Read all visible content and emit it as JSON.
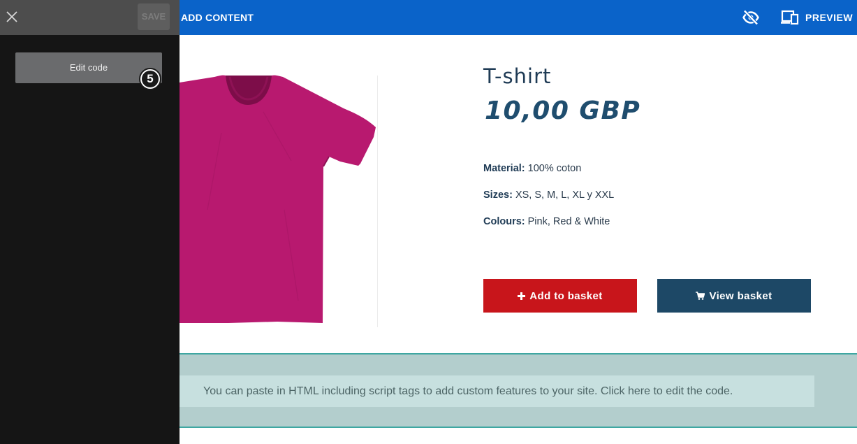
{
  "topbar": {
    "add_content_label": "ADD CONTENT",
    "preview_label": "PREVIEW",
    "background_color": "#0a63c9",
    "icons": [
      "visibility-off-icon",
      "devices-icon"
    ]
  },
  "side_panel": {
    "save_label": "SAVE",
    "edit_code_label": "Edit code",
    "step_badge": "5",
    "icons": [
      "close-icon"
    ]
  },
  "product": {
    "title": "T-shirt",
    "price": "10,00 GBP",
    "material_label": "Material:",
    "material_value": "100% coton",
    "sizes_label": "Sizes:",
    "sizes_value": "XS, S, M, L, XL y XXL",
    "colours_label": "Colours:",
    "colours_value": "Pink, Red & White",
    "add_to_basket_label": "Add to basket",
    "view_basket_label": "View basket",
    "shirt_color": "#b8196f",
    "add_button_color": "#c8151b",
    "view_button_color": "#1d4866"
  },
  "code_block": {
    "notice": "You can paste in HTML including script tags to add custom features to your site. Click here to edit the code."
  }
}
